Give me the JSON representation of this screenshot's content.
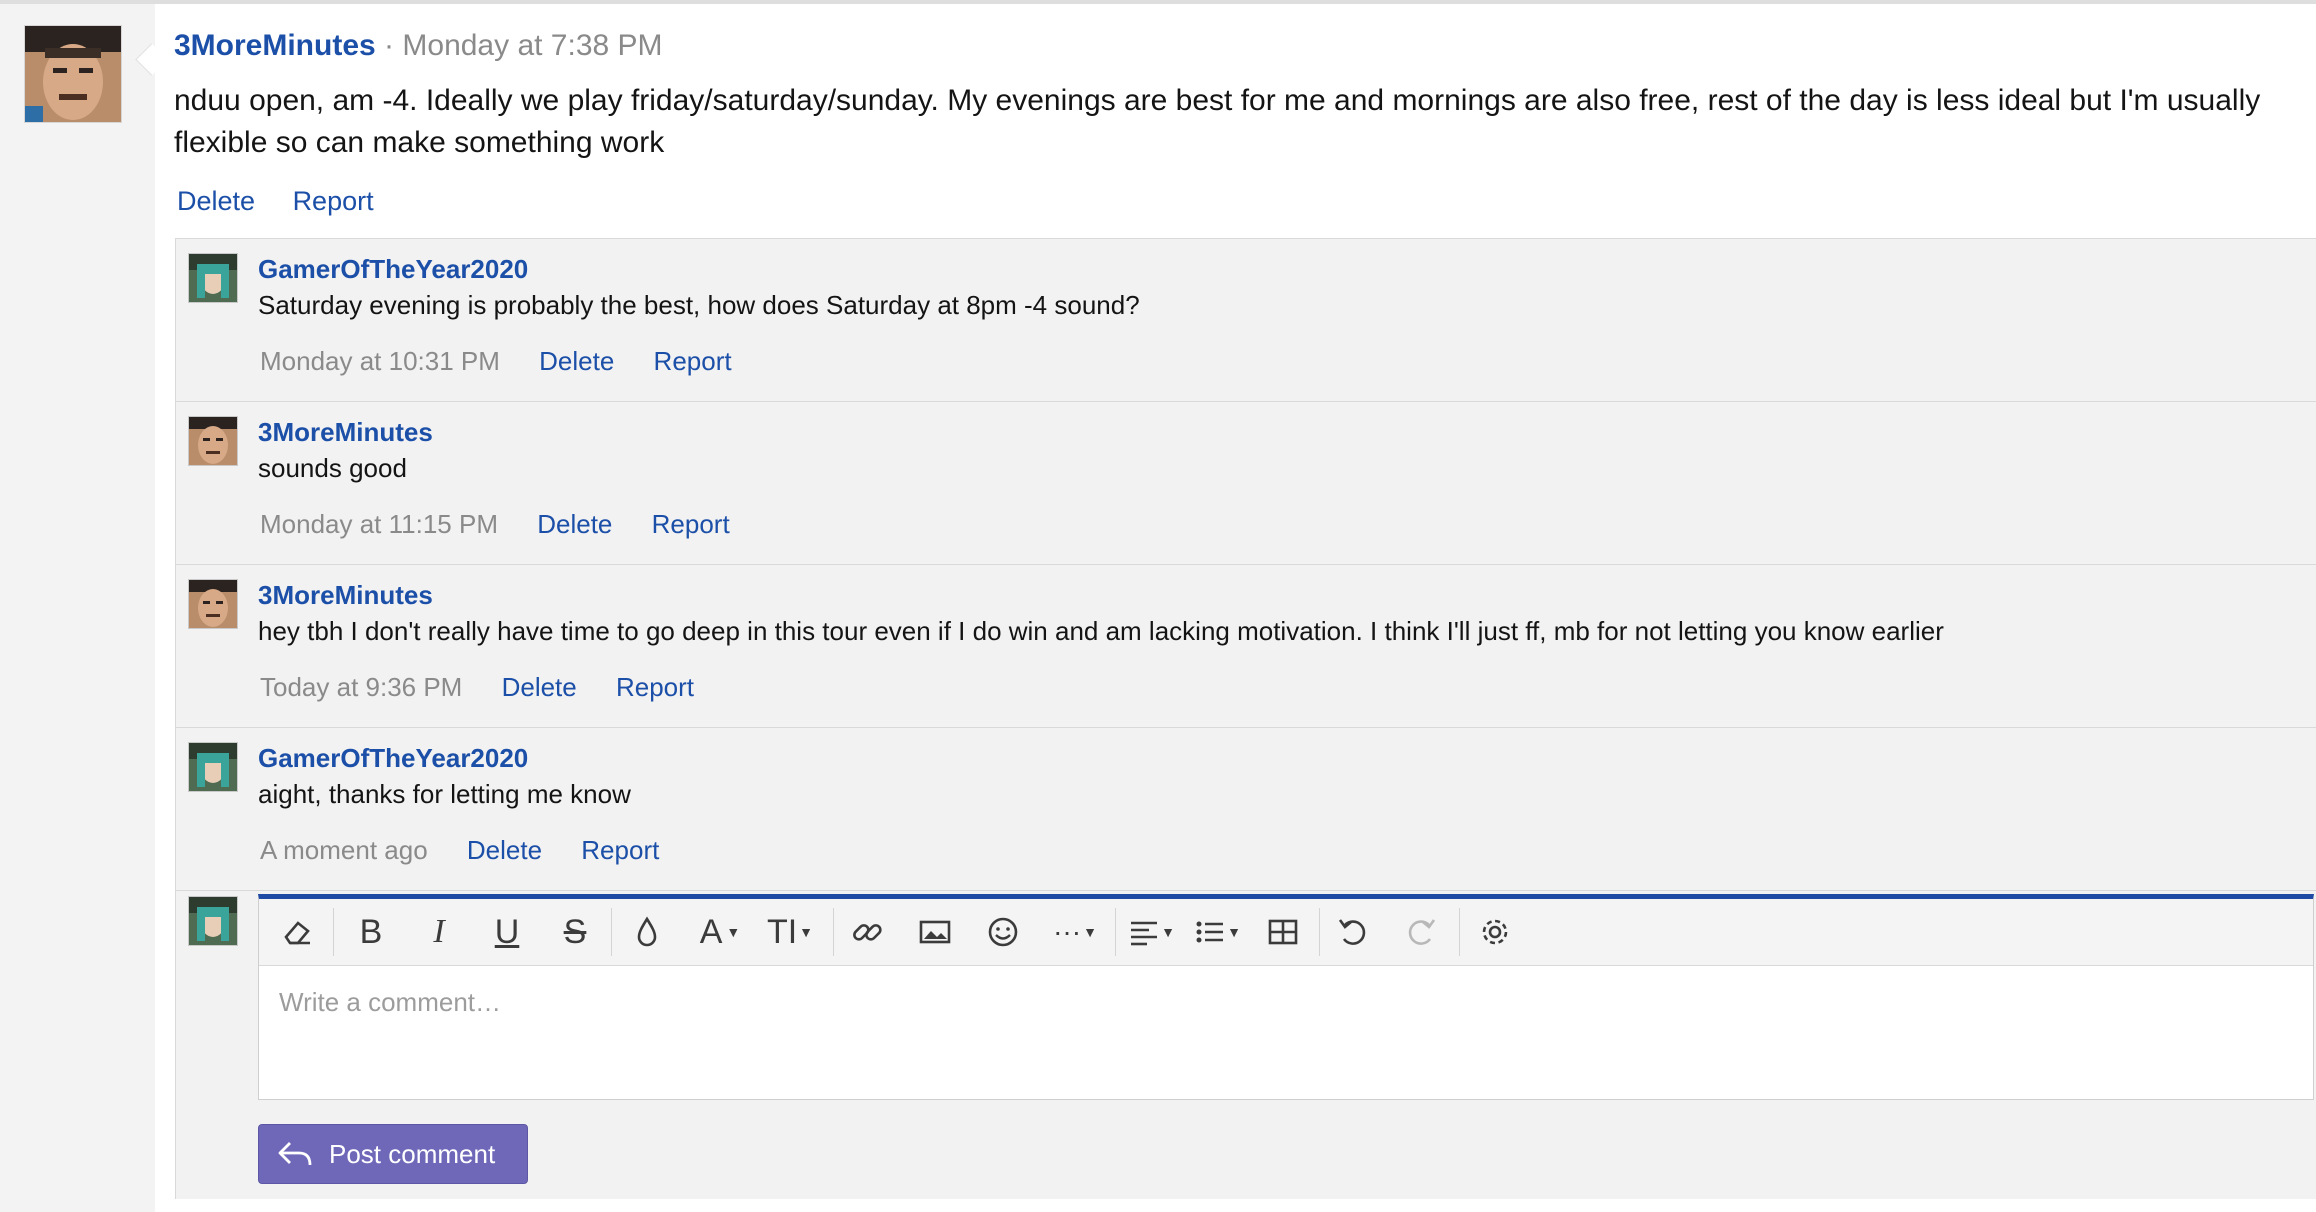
{
  "main_post": {
    "username": "3MoreMinutes",
    "separator": "·",
    "timestamp": "Monday at 7:38 PM",
    "body": "nduu open, am -4. Ideally we play friday/saturday/sunday. My evenings are best for me and mornings are also free, rest of the day is less ideal but I'm usually flexible so can make something work",
    "actions": {
      "delete": "Delete",
      "report": "Report"
    }
  },
  "comments": [
    {
      "username": "GamerOfTheYear2020",
      "text": "Saturday evening is probably the best, how does Saturday at 8pm -4 sound?",
      "timestamp": "Monday at 10:31 PM",
      "delete": "Delete",
      "report": "Report"
    },
    {
      "username": "3MoreMinutes",
      "text": "sounds good",
      "timestamp": "Monday at 11:15 PM",
      "delete": "Delete",
      "report": "Report"
    },
    {
      "username": "3MoreMinutes",
      "text": "hey tbh I don't really have time to go deep in this tour even if I do win and am lacking motivation. I think I'll just ff, mb for not letting you know earlier",
      "timestamp": "Today at 9:36 PM",
      "delete": "Delete",
      "report": "Report"
    },
    {
      "username": "GamerOfTheYear2020",
      "text": "aight, thanks for letting me know",
      "timestamp": "A moment ago",
      "delete": "Delete",
      "report": "Report"
    }
  ],
  "composer": {
    "placeholder": "Write a comment…",
    "post_label": "Post comment",
    "toolbar_icons": [
      "eraser-icon",
      "bold-icon",
      "italic-icon",
      "underline-icon",
      "strikethrough-icon",
      "text-color-icon",
      "font-family-icon",
      "font-size-icon",
      "link-icon",
      "image-icon",
      "emoji-icon",
      "more-icon",
      "align-icon",
      "list-icon",
      "table-icon",
      "undo-icon",
      "redo-icon",
      "settings-icon"
    ],
    "glyphs": {
      "bold": "B",
      "italic": "I",
      "underline": "U",
      "strike": "S",
      "font": "A",
      "size": "TI",
      "more": "···"
    }
  },
  "colors": {
    "link": "#1b4fa8",
    "meta": "#8a8a8a",
    "accent_bar": "#1f4ba5",
    "post_button": "#6f68b9"
  }
}
